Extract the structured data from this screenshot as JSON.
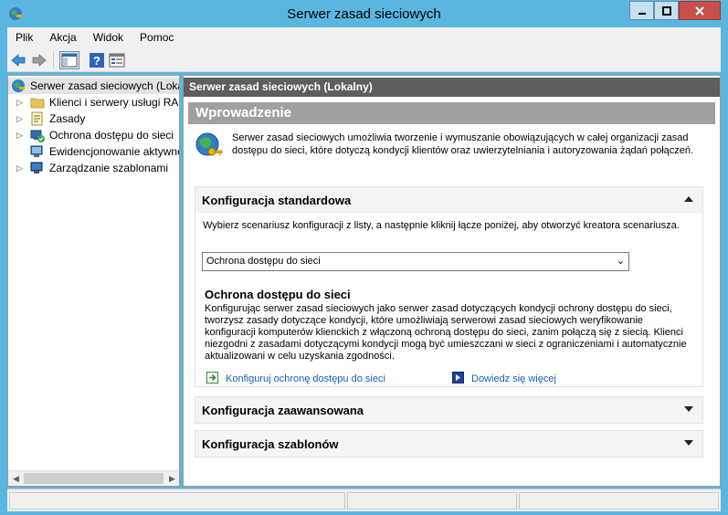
{
  "window": {
    "title": "Serwer zasad sieciowych"
  },
  "menu": [
    "Plik",
    "Akcja",
    "Widok",
    "Pomoc"
  ],
  "toolbar": {
    "buttons": [
      "back-icon",
      "forward-icon",
      "show-hide-console-tree-icon",
      "help-icon",
      "properties-icon"
    ]
  },
  "tree": {
    "root": "Serwer zasad sieciowych (Lokalny)",
    "items": [
      {
        "label": "Klienci i serwery usługi RADIUS",
        "icon": "folder-icon",
        "expandable": true
      },
      {
        "label": "Zasady",
        "icon": "policy-icon",
        "expandable": true
      },
      {
        "label": "Ochrona dostępu do sieci",
        "icon": "nap-icon",
        "expandable": true
      },
      {
        "label": "Ewidencjonowanie aktywności",
        "icon": "accounting-icon",
        "expandable": false
      },
      {
        "label": "Zarządzanie szablonami",
        "icon": "templates-icon",
        "expandable": true
      }
    ]
  },
  "right": {
    "header": "Serwer zasad sieciowych (Lokalny)",
    "intro_title": "Wprowadzenie",
    "intro_text": "Serwer zasad sieciowych umożliwia tworzenie i wymuszanie obowiązujących w całej organizacji zasad dostępu do sieci, które dotyczą kondycji klientów oraz uwierzytelniania i autoryzowania żądań połączeń.",
    "standard": {
      "title": "Konfiguracja standardowa",
      "prompt": "Wybierz scenariusz konfiguracji z listy, a następnie kliknij łącze poniżej, aby otworzyć kreatora scenariusza.",
      "selected": "Ochrona dostępu do sieci",
      "scenario_title": "Ochrona dostępu do sieci",
      "scenario_desc": "Konfigurując serwer zasad sieciowych jako serwer zasad dotyczących kondycji ochrony dostępu do sieci, tworzysz zasady dotyczące kondycji, które umożliwiają serwerowi zasad sieciowych weryfikowanie konfiguracji komputerów klienckich z włączoną ochroną dostępu do sieci, zanim połączą się z siecią. Klienci niezgodni z zasadami dotyczącymi kondycji mogą być umieszczani w sieci z ograniczeniami i automatycznie aktualizowani w celu uzyskania zgodności.",
      "link_configure": "Konfiguruj ochronę dostępu do sieci",
      "link_learn": "Dowiedz się więcej"
    },
    "advanced_title": "Konfiguracja zaawansowana",
    "templates_title": "Konfiguracja szablonów"
  }
}
